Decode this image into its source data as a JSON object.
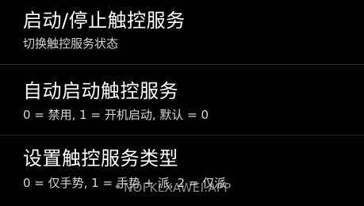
{
  "settings": {
    "items": [
      {
        "title": "启动/停止触控服务",
        "summary": "切换触控服务状态"
      },
      {
        "title": "自动启动触控服务",
        "summary": "0 = 禁用, 1 = 开机启动, 默认 = 0"
      },
      {
        "title": "设置触控服务类型",
        "summary": "0 = 仅手势, 1 = 手势 + 派, 2 = 仅派"
      }
    ]
  },
  "watermark": {
    "text": "NOFKLXAWEI.APP"
  },
  "colors": {
    "background": "#000000",
    "title": "#ffffff",
    "summary": "#d6d6d6",
    "divider": "#2e2e2e"
  }
}
